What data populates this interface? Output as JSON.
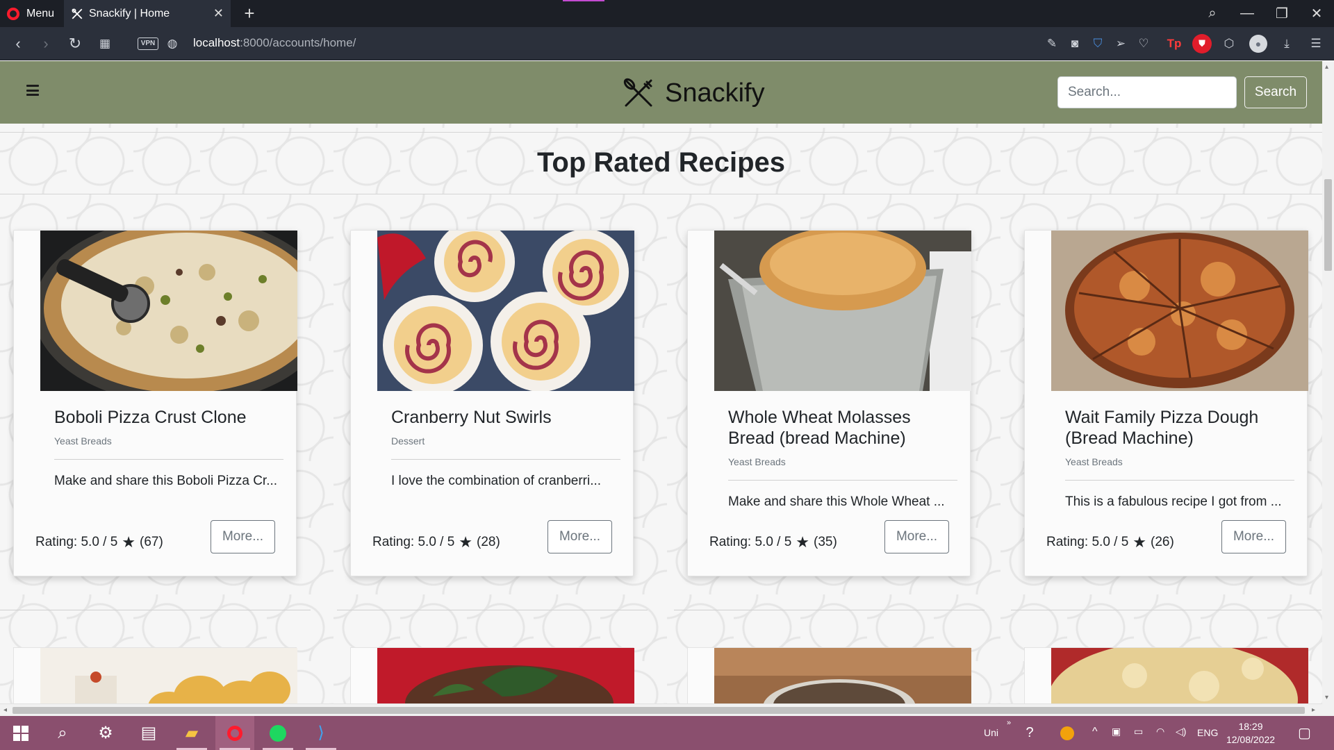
{
  "browser": {
    "menu_label": "Menu",
    "tab_title": "Snackify | Home",
    "url_host": "localhost",
    "url_rest": ":8000/accounts/home/",
    "vpn_label": "VPN",
    "tp_label": "Tp"
  },
  "site": {
    "brand": "Snackify",
    "search_placeholder": "Search...",
    "search_button": "Search",
    "header_color": "#7f8c6a"
  },
  "section": {
    "title": "Top Rated Recipes"
  },
  "recipes": [
    {
      "title": "Boboli Pizza Crust Clone",
      "category": "Yeast Breads",
      "description": "Make and share this Boboli Pizza Cr...",
      "rating": "Rating: 5.0 / 5",
      "reviews": "(67)",
      "more": "More..."
    },
    {
      "title": "Cranberry Nut Swirls",
      "category": "Dessert",
      "description": "I love the combination of cranberri...",
      "rating": "Rating: 5.0 / 5",
      "reviews": "(28)",
      "more": "More..."
    },
    {
      "title": "Whole Wheat Molasses Bread (bread Machine)",
      "category": "Yeast Breads",
      "description": "Make and share this Whole Wheat ...",
      "rating": "Rating: 5.0 / 5",
      "reviews": "(35)",
      "more": "More..."
    },
    {
      "title": "Wait Family Pizza Dough (Bread Machine)",
      "category": "Yeast Breads",
      "description": "This is a fabulous recipe I got from ...",
      "rating": "Rating: 5.0 / 5",
      "reviews": "(26)",
      "more": "More..."
    }
  ],
  "taskbar": {
    "input_label": "Uni",
    "language": "ENG",
    "time": "18:29",
    "date": "12/08/2022",
    "color": "#8a4f6e"
  },
  "icons": [
    "opera-logo-icon",
    "snackify-logo-icon",
    "hamburger-icon",
    "star-icon",
    "windows-start-icon",
    "search-icon",
    "settings-icon",
    "spotify-icon",
    "vscode-icon"
  ]
}
